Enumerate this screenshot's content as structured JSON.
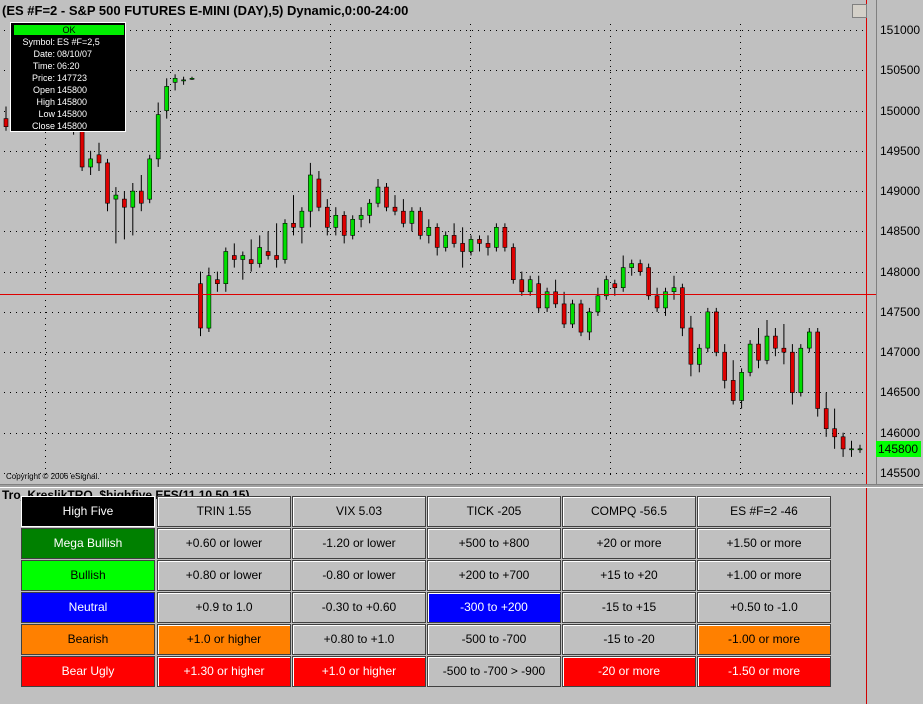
{
  "window": {
    "title": "(ES #F=2 - S&P 500 FUTURES E-MINI (DAY),5) Dynamic,0:00-24:00",
    "close_glyph": ""
  },
  "info_window": {
    "status": "OK",
    "rows": [
      {
        "label": "Symbol:",
        "value": "ES #F=2,5"
      },
      {
        "label": "Date:",
        "value": "08/10/07"
      },
      {
        "label": "Time:",
        "value": "06:20"
      },
      {
        "label": "Price:",
        "value": "147723"
      },
      {
        "label": "Open",
        "value": "145800"
      },
      {
        "label": "High",
        "value": "145800"
      },
      {
        "label": "Low",
        "value": "145800"
      },
      {
        "label": "Close",
        "value": "145800"
      }
    ]
  },
  "copyright": "Copyright © 2006 eSignal.",
  "price_axis": {
    "labels": [
      "151000",
      "150500",
      "150000",
      "149500",
      "149000",
      "148500",
      "148000",
      "147500",
      "147000",
      "146500",
      "146000",
      "145500"
    ],
    "current_price": "145800"
  },
  "colors": {
    "up": "#00dd00",
    "down": "#dd0000",
    "crosshair": "#dd0000",
    "grid": "#000000"
  },
  "study": {
    "title": "Tro_KreslikTRO_$highfive.EFS(11,10,50,15)"
  },
  "table": {
    "columns": [
      {
        "cells": [
          {
            "text": "High Five",
            "bg": "#000000",
            "fg": "#ffffff"
          },
          {
            "text": "Mega Bullish",
            "bg": "#008000",
            "fg": "#ffffff"
          },
          {
            "text": "Bullish",
            "bg": "#00ff00",
            "fg": "#000000"
          },
          {
            "text": "Neutral",
            "bg": "#0000ff",
            "fg": "#ffffff"
          },
          {
            "text": "Bearish",
            "bg": "#ff8000",
            "fg": "#000000"
          },
          {
            "text": "Bear Ugly",
            "bg": "#ff0000",
            "fg": "#ffffff"
          }
        ]
      },
      {
        "cells": [
          {
            "text": "TRIN 1.55",
            "bg": "#c0c0c0",
            "fg": "#000000"
          },
          {
            "text": "+0.60 or lower",
            "bg": "#c0c0c0",
            "fg": "#000000"
          },
          {
            "text": "+0.80 or lower",
            "bg": "#c0c0c0",
            "fg": "#000000"
          },
          {
            "text": "+0.9 to 1.0",
            "bg": "#c0c0c0",
            "fg": "#000000"
          },
          {
            "text": "+1.0 or higher",
            "bg": "#ff8000",
            "fg": "#000000"
          },
          {
            "text": "+1.30 or higher",
            "bg": "#ff0000",
            "fg": "#ffffff"
          }
        ]
      },
      {
        "cells": [
          {
            "text": "VIX 5.03",
            "bg": "#c0c0c0",
            "fg": "#000000"
          },
          {
            "text": "-1.20 or lower",
            "bg": "#c0c0c0",
            "fg": "#000000"
          },
          {
            "text": "-0.80 or lower",
            "bg": "#c0c0c0",
            "fg": "#000000"
          },
          {
            "text": "-0.30 to +0.60",
            "bg": "#c0c0c0",
            "fg": "#000000"
          },
          {
            "text": "+0.80 to +1.0",
            "bg": "#c0c0c0",
            "fg": "#000000"
          },
          {
            "text": "+1.0 or higher",
            "bg": "#ff0000",
            "fg": "#ffffff"
          }
        ]
      },
      {
        "cells": [
          {
            "text": "TICK -205",
            "bg": "#c0c0c0",
            "fg": "#000000"
          },
          {
            "text": "+500 to +800",
            "bg": "#c0c0c0",
            "fg": "#000000"
          },
          {
            "text": "+200 to +700",
            "bg": "#c0c0c0",
            "fg": "#000000"
          },
          {
            "text": "-300 to +200",
            "bg": "#0000ff",
            "fg": "#ffffff"
          },
          {
            "text": "-500 to -700",
            "bg": "#c0c0c0",
            "fg": "#000000"
          },
          {
            "text": "-500 to -700 > -900",
            "bg": "#c0c0c0",
            "fg": "#000000"
          }
        ]
      },
      {
        "cells": [
          {
            "text": "COMPQ -56.5",
            "bg": "#c0c0c0",
            "fg": "#000000"
          },
          {
            "text": "+20 or more",
            "bg": "#c0c0c0",
            "fg": "#000000"
          },
          {
            "text": "+15 to +20",
            "bg": "#c0c0c0",
            "fg": "#000000"
          },
          {
            "text": "-15 to +15",
            "bg": "#c0c0c0",
            "fg": "#000000"
          },
          {
            "text": "-15 to -20",
            "bg": "#c0c0c0",
            "fg": "#000000"
          },
          {
            "text": "-20 or more",
            "bg": "#ff0000",
            "fg": "#ffffff"
          }
        ]
      },
      {
        "cells": [
          {
            "text": "ES #F=2 -46",
            "bg": "#c0c0c0",
            "fg": "#000000"
          },
          {
            "text": "+1.50 or more",
            "bg": "#c0c0c0",
            "fg": "#000000"
          },
          {
            "text": "+1.00 or more",
            "bg": "#c0c0c0",
            "fg": "#000000"
          },
          {
            "text": "+0.50 to -1.0",
            "bg": "#c0c0c0",
            "fg": "#000000"
          },
          {
            "text": "-1.00 or more",
            "bg": "#ff8000",
            "fg": "#000000"
          },
          {
            "text": "-1.50 or more",
            "bg": "#ff0000",
            "fg": "#ffffff"
          }
        ]
      }
    ]
  },
  "chart_data": {
    "type": "candlestick",
    "price_levels": [
      151000,
      150500,
      150000,
      149500,
      149000,
      148500,
      148000,
      147500,
      147000,
      146500,
      146000,
      145500
    ],
    "crosshair_price": 147723,
    "candles": [
      [
        149900,
        150050,
        149750,
        149800
      ],
      [
        150600,
        150950,
        150500,
        150850
      ],
      [
        150900,
        151050,
        150750,
        150800
      ],
      [
        150800,
        151000,
        150600,
        150650
      ],
      [
        150700,
        150750,
        150450,
        150500
      ],
      [
        150500,
        150550,
        150350,
        150450
      ],
      [
        150450,
        150500,
        150250,
        150300
      ],
      [
        150300,
        150350,
        149950,
        150000
      ],
      [
        150100,
        150150,
        149700,
        149750
      ],
      [
        149800,
        149850,
        149250,
        149300
      ],
      [
        149300,
        149500,
        149200,
        149400
      ],
      [
        149450,
        149600,
        149250,
        149350
      ],
      [
        149350,
        149400,
        148750,
        148850
      ],
      [
        148900,
        149050,
        148350,
        148950
      ],
      [
        148900,
        149000,
        148400,
        148800
      ],
      [
        148800,
        149100,
        148450,
        149000
      ],
      [
        149000,
        149200,
        148750,
        148850
      ],
      [
        148900,
        149450,
        148850,
        149400
      ],
      [
        149400,
        150100,
        149300,
        149950
      ],
      [
        150000,
        150400,
        149900,
        150300
      ],
      [
        150350,
        150450,
        150250,
        150400
      ],
      [
        150380,
        150420,
        150320,
        150380
      ],
      [
        150400,
        150420,
        150380,
        150400
      ],
      [
        147850,
        148000,
        147200,
        147300
      ],
      [
        147300,
        148050,
        147250,
        147950
      ],
      [
        147900,
        148000,
        147750,
        147850
      ],
      [
        147850,
        148300,
        147750,
        148250
      ],
      [
        148200,
        148350,
        148050,
        148150
      ],
      [
        148150,
        148250,
        147900,
        148200
      ],
      [
        148150,
        148400,
        148000,
        148100
      ],
      [
        148100,
        148450,
        148050,
        148300
      ],
      [
        148250,
        148500,
        148150,
        148200
      ],
      [
        148200,
        148600,
        148050,
        148150
      ],
      [
        148150,
        148650,
        148100,
        148600
      ],
      [
        148600,
        148950,
        148450,
        148550
      ],
      [
        148550,
        148800,
        148350,
        148750
      ],
      [
        148750,
        149350,
        148550,
        149200
      ],
      [
        149150,
        149250,
        148750,
        148800
      ],
      [
        148800,
        148900,
        148450,
        148550
      ],
      [
        148550,
        148800,
        148450,
        148700
      ],
      [
        148700,
        148750,
        148350,
        148450
      ],
      [
        148450,
        148700,
        148400,
        148650
      ],
      [
        148650,
        148800,
        148550,
        148700
      ],
      [
        148700,
        148900,
        148600,
        148850
      ],
      [
        148850,
        149150,
        148800,
        149050
      ],
      [
        149050,
        149100,
        148750,
        148800
      ],
      [
        148800,
        148950,
        148700,
        148750
      ],
      [
        148750,
        148900,
        148550,
        148600
      ],
      [
        148600,
        148800,
        148500,
        148750
      ],
      [
        148750,
        148800,
        148400,
        148450
      ],
      [
        148450,
        148650,
        148350,
        148550
      ],
      [
        148550,
        148600,
        148200,
        148300
      ],
      [
        148300,
        148500,
        148250,
        148450
      ],
      [
        148450,
        148600,
        148300,
        148350
      ],
      [
        148350,
        148550,
        148050,
        148250
      ],
      [
        148250,
        148450,
        148200,
        148400
      ],
      [
        148400,
        148450,
        148250,
        148350
      ],
      [
        148350,
        148450,
        148200,
        148300
      ],
      [
        148300,
        148600,
        148250,
        148550
      ],
      [
        148550,
        148600,
        148250,
        148300
      ],
      [
        148300,
        148350,
        147850,
        147900
      ],
      [
        147900,
        148000,
        147700,
        147750
      ],
      [
        147750,
        147950,
        147700,
        147900
      ],
      [
        147850,
        147950,
        147500,
        147550
      ],
      [
        147550,
        147800,
        147500,
        147750
      ],
      [
        147750,
        147900,
        147550,
        147600
      ],
      [
        147600,
        147750,
        147300,
        147350
      ],
      [
        147350,
        147650,
        147300,
        147600
      ],
      [
        147600,
        147650,
        147200,
        147250
      ],
      [
        147250,
        147550,
        147150,
        147500
      ],
      [
        147500,
        147800,
        147450,
        147700
      ],
      [
        147700,
        147950,
        147650,
        147900
      ],
      [
        147850,
        147900,
        147700,
        147800
      ],
      [
        147800,
        148200,
        147750,
        148050
      ],
      [
        148050,
        148150,
        147950,
        148100
      ],
      [
        148100,
        148150,
        147950,
        148000
      ],
      [
        148050,
        148100,
        147650,
        147700
      ],
      [
        147700,
        147800,
        147500,
        147550
      ],
      [
        147550,
        147800,
        147450,
        147750
      ],
      [
        147750,
        147950,
        147650,
        147800
      ],
      [
        147800,
        147850,
        147200,
        147300
      ],
      [
        147300,
        147450,
        146700,
        146850
      ],
      [
        146850,
        147100,
        146750,
        147050
      ],
      [
        147050,
        147550,
        147000,
        147500
      ],
      [
        147500,
        147550,
        146950,
        147000
      ],
      [
        147000,
        147100,
        146550,
        146650
      ],
      [
        146650,
        146900,
        146350,
        146400
      ],
      [
        146400,
        146800,
        146300,
        146750
      ],
      [
        146750,
        147150,
        146700,
        147100
      ],
      [
        147100,
        147300,
        146800,
        146900
      ],
      [
        146900,
        147400,
        146850,
        147200
      ],
      [
        147200,
        147300,
        146950,
        147050
      ],
      [
        147050,
        147350,
        146850,
        147000
      ],
      [
        147000,
        147100,
        146350,
        146500
      ],
      [
        146500,
        147100,
        146450,
        147050
      ],
      [
        147050,
        147300,
        147000,
        147250
      ],
      [
        147250,
        147300,
        146200,
        146300
      ],
      [
        146300,
        146500,
        145950,
        146050
      ],
      [
        146050,
        146300,
        145800,
        145950
      ],
      [
        145950,
        146000,
        145700,
        145800
      ],
      [
        145800,
        145900,
        145700,
        145800
      ],
      [
        145800,
        145850,
        145750,
        145800
      ]
    ]
  }
}
